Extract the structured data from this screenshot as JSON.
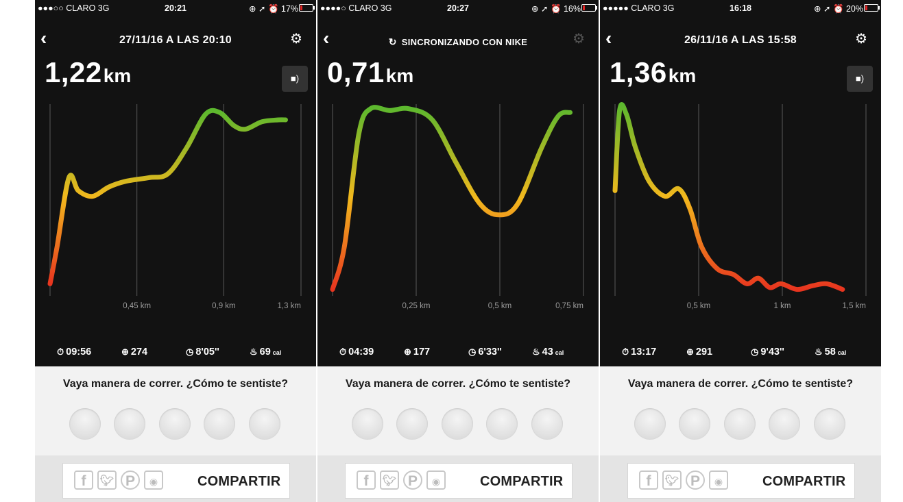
{
  "colors": {
    "dark_bg": "#121212",
    "light_bg": "#f2f2f2",
    "share_bg": "#e4e4e4",
    "curve_low": "#e8351f",
    "curve_mid": "#f2b81d",
    "curve_high": "#5cb82e"
  },
  "icons": {
    "back": "chevron-left-icon",
    "settings": "gear-icon",
    "music": "music-speaker-icon",
    "sync": "sync-icon",
    "time": "stopwatch-icon",
    "steps": "steps-icon",
    "pace": "clock-icon",
    "calories": "flame-icon"
  },
  "screens": [
    {
      "status": {
        "carrier": "●●●○○ CLARO  3G",
        "time": "20:21",
        "indicators": "⊕ ➚ ⏰ 17%",
        "battery": 0.17
      },
      "title": "27/11/16 A LAS 20:10",
      "distance": {
        "value": "1,22",
        "unit": "km"
      },
      "chart": {
        "ticks": [
          "0,45 km",
          "0,9 km",
          "1,3 km"
        ],
        "tick_values": [
          0.45,
          0.9,
          1.3
        ],
        "x_max": 1.22,
        "curve": [
          [
            0,
            0.05
          ],
          [
            0.03,
            0.25
          ],
          [
            0.08,
            0.62
          ],
          [
            0.12,
            0.55
          ],
          [
            0.18,
            0.52
          ],
          [
            0.25,
            0.57
          ],
          [
            0.32,
            0.6
          ],
          [
            0.42,
            0.62
          ],
          [
            0.5,
            0.64
          ],
          [
            0.58,
            0.78
          ],
          [
            0.66,
            0.96
          ],
          [
            0.72,
            0.97
          ],
          [
            0.78,
            0.9
          ],
          [
            0.83,
            0.88
          ],
          [
            0.9,
            0.92
          ],
          [
            0.97,
            0.93
          ],
          [
            1.0,
            0.93
          ]
        ]
      },
      "stats": {
        "time": "09:56",
        "steps": "274",
        "pace": "8'05''",
        "calories": "69",
        "cal_unit": "cal"
      },
      "question": "Vaya manera de correr. ¿Cómo te sentiste?",
      "share_label": "COMPARTIR"
    },
    {
      "status": {
        "carrier": "●●●●○ CLARO  3G",
        "time": "20:27",
        "indicators": "⊕ ➚ ⏰ 16%",
        "battery": 0.16
      },
      "title": "SINCRONIZANDO CON NIKE",
      "distance": {
        "value": "0,71",
        "unit": "km"
      },
      "chart": {
        "ticks": [
          "0,25 km",
          "0,5 km",
          "0,75 km"
        ],
        "tick_values": [
          0.25,
          0.5,
          0.75
        ],
        "x_max": 0.71,
        "curve": [
          [
            0,
            0.02
          ],
          [
            0.05,
            0.25
          ],
          [
            0.11,
            0.85
          ],
          [
            0.16,
            0.99
          ],
          [
            0.24,
            0.98
          ],
          [
            0.32,
            0.99
          ],
          [
            0.42,
            0.93
          ],
          [
            0.52,
            0.7
          ],
          [
            0.62,
            0.48
          ],
          [
            0.7,
            0.42
          ],
          [
            0.78,
            0.48
          ],
          [
            0.88,
            0.78
          ],
          [
            0.95,
            0.95
          ],
          [
            1.0,
            0.97
          ]
        ]
      },
      "stats": {
        "time": "04:39",
        "steps": "177",
        "pace": "6'33''",
        "calories": "43",
        "cal_unit": "cal"
      },
      "question": "Vaya manera de correr. ¿Cómo te sentiste?",
      "share_label": "COMPARTIR"
    },
    {
      "status": {
        "carrier": "●●●●● CLARO  3G",
        "time": "16:18",
        "indicators": "⊕ ➚ ⏰ 20%",
        "battery": 0.2
      },
      "title": "26/11/16 A LAS 15:58",
      "distance": {
        "value": "1,36",
        "unit": "km"
      },
      "chart": {
        "ticks": [
          "0,5 km",
          "1 km",
          "1,5 km"
        ],
        "tick_values": [
          0.5,
          1.0,
          1.5
        ],
        "x_max": 1.36,
        "curve": [
          [
            0,
            0.55
          ],
          [
            0.02,
            0.98
          ],
          [
            0.05,
            0.96
          ],
          [
            0.09,
            0.78
          ],
          [
            0.15,
            0.6
          ],
          [
            0.22,
            0.52
          ],
          [
            0.28,
            0.56
          ],
          [
            0.33,
            0.45
          ],
          [
            0.38,
            0.25
          ],
          [
            0.45,
            0.13
          ],
          [
            0.52,
            0.1
          ],
          [
            0.58,
            0.05
          ],
          [
            0.63,
            0.08
          ],
          [
            0.68,
            0.03
          ],
          [
            0.73,
            0.05
          ],
          [
            0.8,
            0.02
          ],
          [
            0.87,
            0.04
          ],
          [
            0.93,
            0.05
          ],
          [
            1.0,
            0.02
          ]
        ]
      },
      "stats": {
        "time": "13:17",
        "steps": "291",
        "pace": "9'43''",
        "calories": "58",
        "cal_unit": "cal"
      },
      "question": "Vaya manera de correr. ¿Cómo te sentiste?",
      "share_label": "COMPARTIR"
    }
  ]
}
